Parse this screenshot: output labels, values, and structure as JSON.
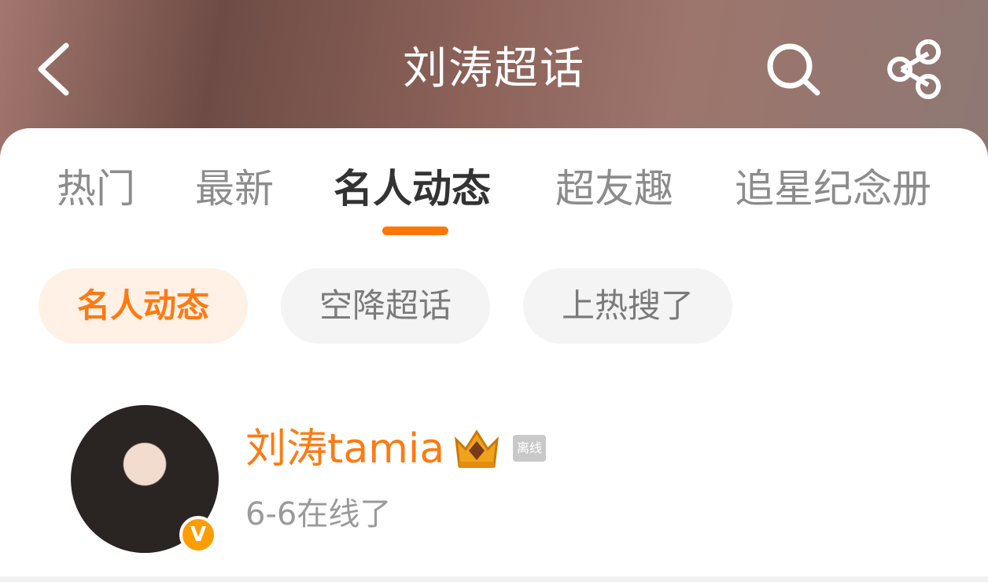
{
  "header": {
    "title": "刘涛超话",
    "back_icon": "chevron-left-icon",
    "search_icon": "search-icon",
    "share_icon": "share-icon"
  },
  "tabs": [
    {
      "label": "热门",
      "active": false
    },
    {
      "label": "最新",
      "active": false
    },
    {
      "label": "名人动态",
      "active": true
    },
    {
      "label": "超友趣",
      "active": false
    },
    {
      "label": "追星纪念册",
      "active": false
    }
  ],
  "filters": [
    {
      "label": "名人动态",
      "active": true
    },
    {
      "label": "空降超话",
      "active": false
    },
    {
      "label": "上热搜了",
      "active": false
    }
  ],
  "celebrity": {
    "name": "刘涛tamia",
    "status_tag": "离线",
    "last_online": "6-6在线了",
    "verified_badge": "V"
  },
  "colors": {
    "accent": "#ff7a10",
    "tab_indicator": "#ff7700",
    "header_gradient_mid": "#8c6259"
  }
}
